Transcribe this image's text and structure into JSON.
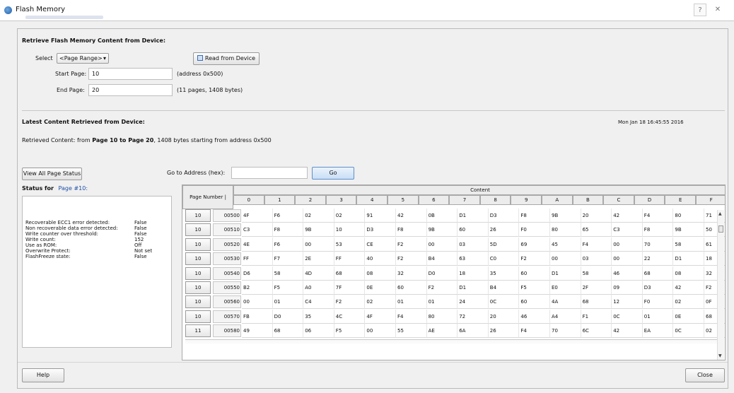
{
  "window": {
    "title": "Flash Memory",
    "help_glyph": "?",
    "close_glyph": "✕"
  },
  "retrieve": {
    "section_title": "Retrieve Flash Memory Content from Device:",
    "select_label": "Select",
    "select_value": "<Page Range>",
    "read_button": "Read from Device",
    "start_label": "Start Page:",
    "start_value": "10",
    "start_note": "(address 0x500)",
    "end_label": "End Page:",
    "end_value": "20",
    "end_note": "(11 pages, 1408 bytes)"
  },
  "latest": {
    "section_title": "Latest Content Retrieved from Device:",
    "timestamp": "Mon Jan 18 16:45:55 2016",
    "retrieved_prefix": "Retrieved Content:  from ",
    "retrieved_bold": "Page 10 to Page 20",
    "retrieved_suffix": ", 1408 bytes starting from address 0x500"
  },
  "status": {
    "view_all_button": "View All Page Status",
    "status_for_label": "Status for",
    "status_for_page": "Page #10:",
    "rows": [
      {
        "label": "Recoverable ECC1 error detected:",
        "value": "False"
      },
      {
        "label": "Non recoverable data error detected:",
        "value": "False"
      },
      {
        "label": "Write counter over threshold:",
        "value": "False"
      },
      {
        "label": "Write count:",
        "value": "152"
      },
      {
        "label": "Use as ROM:",
        "value": "Off"
      },
      {
        "label": "Overwrite Protect:",
        "value": "Not set"
      },
      {
        "label": "FlashFreeze state:",
        "value": "False"
      }
    ]
  },
  "goto": {
    "label": "Go to Address (hex):",
    "value": "",
    "go_button": "Go"
  },
  "grid": {
    "page_header": "Page Number | Address",
    "content_header": "Content",
    "columns": [
      "0",
      "1",
      "2",
      "3",
      "4",
      "5",
      "6",
      "7",
      "8",
      "9",
      "A",
      "B",
      "C",
      "D",
      "E",
      "F"
    ],
    "rows": [
      {
        "page": "10",
        "address": "00500",
        "bytes": [
          "4F",
          "F6",
          "02",
          "02",
          "91",
          "42",
          "0B",
          "D1",
          "D3",
          "F8",
          "9B",
          "20",
          "42",
          "F4",
          "80",
          "71"
        ]
      },
      {
        "page": "10",
        "address": "00510",
        "bytes": [
          "C3",
          "F8",
          "9B",
          "10",
          "D3",
          "F8",
          "9B",
          "60",
          "26",
          "F0",
          "80",
          "65",
          "C3",
          "F8",
          "9B",
          "50"
        ]
      },
      {
        "page": "10",
        "address": "00520",
        "bytes": [
          "4E",
          "F6",
          "00",
          "53",
          "CE",
          "F2",
          "00",
          "03",
          "5D",
          "69",
          "45",
          "F4",
          "00",
          "70",
          "58",
          "61"
        ]
      },
      {
        "page": "10",
        "address": "00530",
        "bytes": [
          "FF",
          "F7",
          "2E",
          "FF",
          "40",
          "F2",
          "B4",
          "63",
          "C0",
          "F2",
          "00",
          "03",
          "00",
          "22",
          "D1",
          "18"
        ]
      },
      {
        "page": "10",
        "address": "00540",
        "bytes": [
          "D6",
          "58",
          "4D",
          "68",
          "08",
          "32",
          "D0",
          "18",
          "35",
          "60",
          "D1",
          "58",
          "46",
          "68",
          "08",
          "32"
        ]
      },
      {
        "page": "10",
        "address": "00550",
        "bytes": [
          "B2",
          "F5",
          "A0",
          "7F",
          "0E",
          "60",
          "F2",
          "D1",
          "B4",
          "F5",
          "E0",
          "2F",
          "09",
          "D3",
          "42",
          "F2"
        ]
      },
      {
        "page": "10",
        "address": "00560",
        "bytes": [
          "00",
          "01",
          "C4",
          "F2",
          "02",
          "01",
          "01",
          "24",
          "0C",
          "60",
          "4A",
          "68",
          "12",
          "F0",
          "02",
          "0F"
        ]
      },
      {
        "page": "10",
        "address": "00570",
        "bytes": [
          "FB",
          "D0",
          "35",
          "4C",
          "4F",
          "F4",
          "80",
          "72",
          "20",
          "46",
          "A4",
          "F1",
          "0C",
          "01",
          "0E",
          "68"
        ]
      },
      {
        "page": "11",
        "address": "00580",
        "bytes": [
          "49",
          "68",
          "06",
          "F5",
          "00",
          "55",
          "AE",
          "6A",
          "26",
          "F4",
          "70",
          "6C",
          "42",
          "EA",
          "0C",
          "02"
        ]
      }
    ]
  },
  "footer": {
    "help_button": "Help",
    "close_button": "Close"
  }
}
